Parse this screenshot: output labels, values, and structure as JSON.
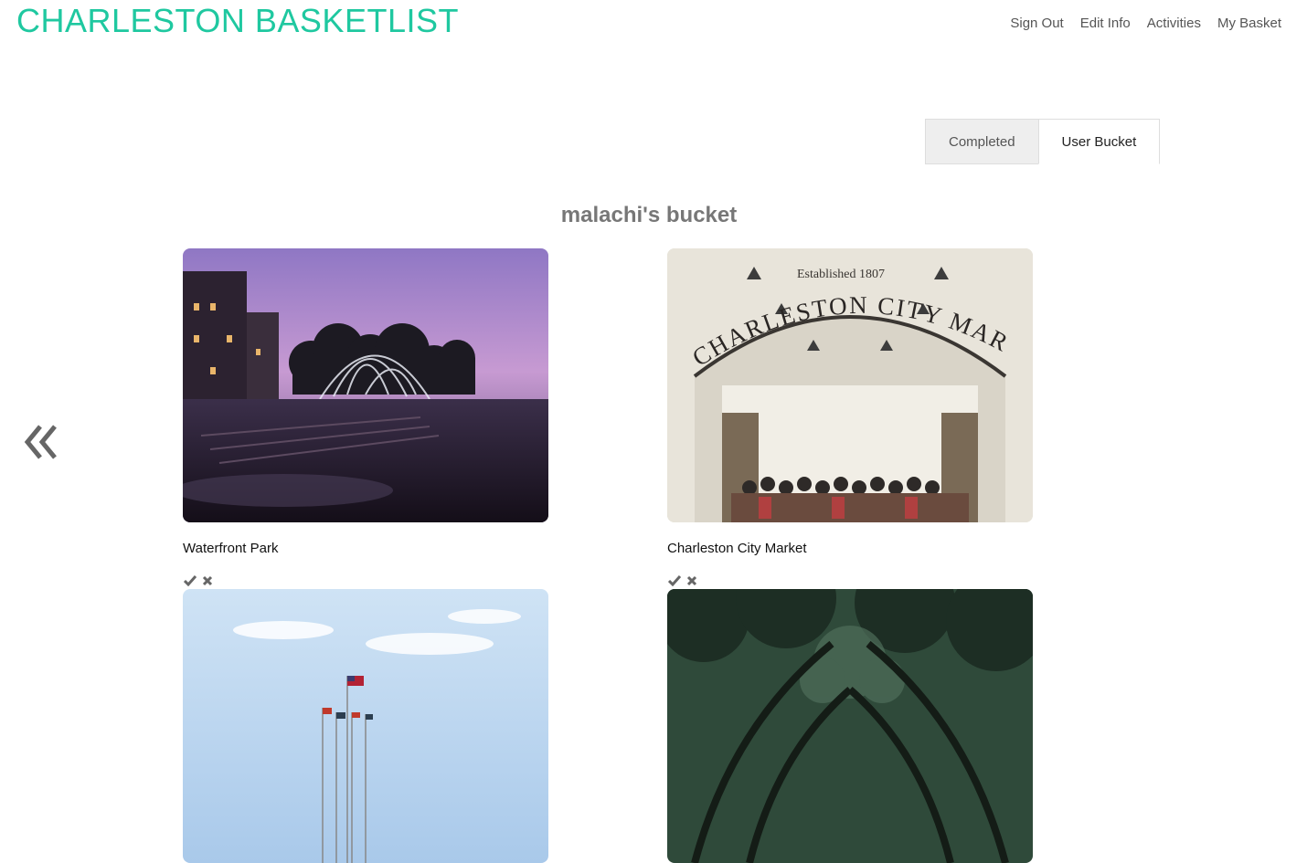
{
  "brand": {
    "title": "CHARLESTON BASKETLIST"
  },
  "nav": {
    "sign_out": "Sign Out",
    "edit_info": "Edit Info",
    "activities": "Activities",
    "my_basket": "My Basket"
  },
  "tabs": [
    {
      "label": "Completed",
      "active": false
    },
    {
      "label": "User Bucket",
      "active": true
    }
  ],
  "page_title": "malachi's bucket",
  "market_sign": {
    "established": "Established 1807",
    "name": "CHARLESTON CITY MARKET"
  },
  "cards": [
    {
      "name": "Waterfront Park"
    },
    {
      "name": "Charleston City Market"
    },
    {
      "name": ""
    },
    {
      "name": ""
    }
  ],
  "icons": {
    "previous": "double-chevron-left-icon",
    "complete": "check-icon",
    "remove": "x-icon"
  },
  "colors": {
    "brand": "#1fc8a0",
    "nav_text": "#555555",
    "title": "#777777",
    "tab_inactive_bg": "#eeeeee"
  }
}
